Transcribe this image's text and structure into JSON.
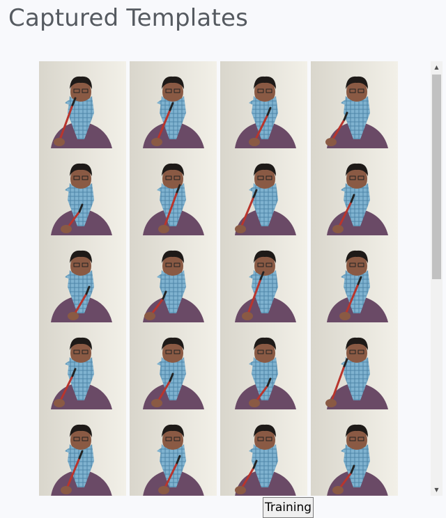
{
  "page": {
    "title": "Captured Templates"
  },
  "gallery": {
    "columns": 4,
    "thumbnail_count": 20,
    "thumbnail_content": "webcam-face-capture",
    "colors": {
      "wall": "#ebe8e1",
      "skin": "#8a5a44",
      "hair": "#1e1a18",
      "scarf": "#7fb2cf",
      "shirt": "#6a4a66",
      "rod": "#b8352d"
    }
  },
  "scrollbar": {
    "up_icon": "arrow-up-icon",
    "down_icon": "arrow-down-icon"
  },
  "actions": {
    "train_label": "Training"
  }
}
